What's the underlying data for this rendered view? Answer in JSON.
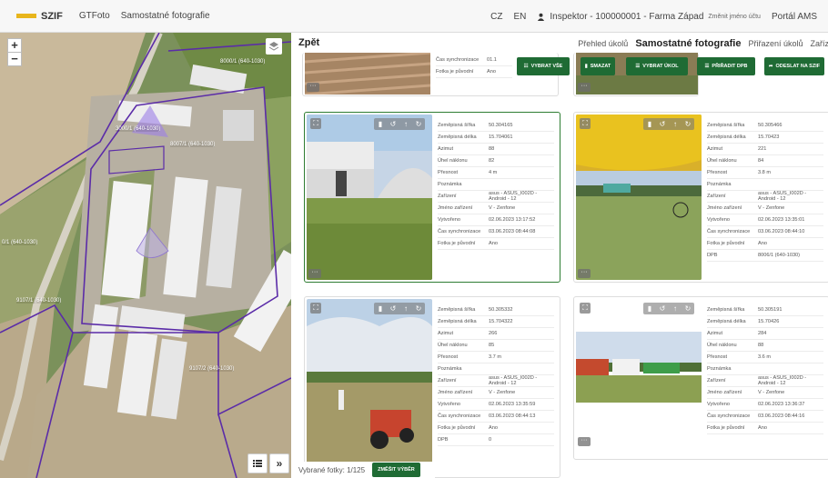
{
  "topbar": {
    "logo": "SZIF",
    "app": "GTFoto",
    "section": "Samostatné fotografie",
    "lang_cz": "CZ",
    "lang_en": "EN",
    "user": "Inspektor - 100000001 - Farma Západ",
    "change_name": "Změnit jméno účtu",
    "portal": "Portál AMS"
  },
  "map": {
    "labels": [
      "8000/1 (640-1030)",
      "3000/1 (640-1030)",
      "8007/1 (640-1030)",
      "0/1 (640-1030)",
      "9107/1 (640-1030)",
      "9107/2 (640-1030)"
    ],
    "zoom_in": "+",
    "zoom_out": "−"
  },
  "main": {
    "back": "Zpět",
    "tabs": [
      "Přehled úkolů",
      "Samostatné fotografie",
      "Přiřazení úkolů",
      "Zaříze"
    ],
    "toolbar": {
      "select_all": "VYBRAT VŠE",
      "delete": "SMAZAT",
      "select_task": "VYBRAT ÚKOL",
      "assign_dpb": "PŘIŘADIT DPB",
      "send": "ODESLAT NA SZIF"
    }
  },
  "top_partial": {
    "rows": [
      {
        "k": "Čas synchronizace",
        "v": "01.1"
      },
      {
        "k": "Fotka je původní",
        "v": "Ano"
      }
    ]
  },
  "cards": [
    {
      "rows": [
        {
          "k": "Zeměpisná šířka",
          "v": "50.304165"
        },
        {
          "k": "Zeměpisná délka",
          "v": "15.704061"
        },
        {
          "k": "Azimut",
          "v": "88"
        },
        {
          "k": "Úhel náklonu",
          "v": "82"
        },
        {
          "k": "Přesnost",
          "v": "4 m"
        },
        {
          "k": "Poznámka",
          "v": ""
        },
        {
          "k": "Zařízení",
          "v": "asus - ASUS_I002D - Android - 12"
        },
        {
          "k": "Jméno zařízení",
          "v": "V - Zenfone"
        },
        {
          "k": "Vytvořeno",
          "v": "02.06.2023 13:17:52"
        },
        {
          "k": "Čas synchronizace",
          "v": "03.06.2023 08:44:08"
        },
        {
          "k": "Fotka je původní",
          "v": "Ano"
        }
      ]
    },
    {
      "rows": [
        {
          "k": "Zeměpisná šířka",
          "v": "50.305466"
        },
        {
          "k": "Zeměpisná délka",
          "v": "15.70423"
        },
        {
          "k": "Azimut",
          "v": "221"
        },
        {
          "k": "Úhel náklonu",
          "v": "84"
        },
        {
          "k": "Přesnost",
          "v": "3.8 m"
        },
        {
          "k": "Poznámka",
          "v": ""
        },
        {
          "k": "Zařízení",
          "v": "asus - ASUS_I002D - Android - 12"
        },
        {
          "k": "Jméno zařízení",
          "v": "V - Zenfone"
        },
        {
          "k": "Vytvořeno",
          "v": "02.06.2023 13:35:01"
        },
        {
          "k": "Čas synchronizace",
          "v": "03.06.2023 08:44:10"
        },
        {
          "k": "Fotka je původní",
          "v": "Ano"
        },
        {
          "k": "DPB",
          "v": "8006/1 (640-1030)"
        }
      ]
    },
    {
      "rows": [
        {
          "k": "Zeměpisná šířka",
          "v": "50.305332"
        },
        {
          "k": "Zeměpisná délka",
          "v": "15.704322"
        },
        {
          "k": "Azimut",
          "v": "266"
        },
        {
          "k": "Úhel náklonu",
          "v": "85"
        },
        {
          "k": "Přesnost",
          "v": "3.7 m"
        },
        {
          "k": "Poznámka",
          "v": ""
        },
        {
          "k": "Zařízení",
          "v": "asus - ASUS_I002D - Android - 12"
        },
        {
          "k": "Jméno zařízení",
          "v": "V - Zenfone"
        },
        {
          "k": "Vytvořeno",
          "v": "02.06.2023 13:35:59"
        },
        {
          "k": "Čas synchronizace",
          "v": "03.06.2023 08:44:13"
        },
        {
          "k": "Fotka je původní",
          "v": "Ano"
        },
        {
          "k": "DPB",
          "v": "0"
        }
      ]
    },
    {
      "rows": [
        {
          "k": "Zeměpisná šířka",
          "v": "50.305191"
        },
        {
          "k": "Zeměpisná délka",
          "v": "15.70426"
        },
        {
          "k": "Azimut",
          "v": "284"
        },
        {
          "k": "Úhel náklonu",
          "v": "88"
        },
        {
          "k": "Přesnost",
          "v": "3.6 m"
        },
        {
          "k": "Poznámka",
          "v": ""
        },
        {
          "k": "Zařízení",
          "v": "asus - ASUS_I002D - Android - 12"
        },
        {
          "k": "Jméno zařízení",
          "v": "V - Zenfone"
        },
        {
          "k": "Vytvořeno",
          "v": "02.06.2023 13:36:37"
        },
        {
          "k": "Čas synchronizace",
          "v": "03.06.2023 08:44:16"
        },
        {
          "k": "Fotka je původní",
          "v": "Ano"
        }
      ]
    }
  ],
  "footer": {
    "selected": "Vybrané fotky: 1/125",
    "zoom_button": "ZMĚŠIT VÝBĚR"
  },
  "colors": {
    "accent": "#1f6b34",
    "brand": "#e8b51c",
    "parcel": "#5b2ca8"
  }
}
